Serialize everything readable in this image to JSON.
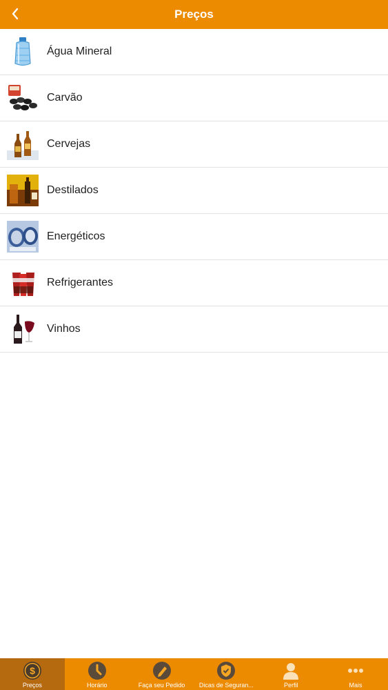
{
  "header": {
    "title": "Preços",
    "back_icon": "chevron-left-icon"
  },
  "colors": {
    "accent": "#ec8a00",
    "active_tab": "#b56a10"
  },
  "categories": [
    {
      "label": "Água Mineral",
      "icon": "water-bottle-icon"
    },
    {
      "label": "Carvão",
      "icon": "charcoal-icon"
    },
    {
      "label": "Cervejas",
      "icon": "beer-bottles-icon"
    },
    {
      "label": "Destilados",
      "icon": "spirits-icon"
    },
    {
      "label": "Energéticos",
      "icon": "energy-drink-icon"
    },
    {
      "label": "Refrigerantes",
      "icon": "soda-icon"
    },
    {
      "label": "Vinhos",
      "icon": "wine-icon"
    }
  ],
  "tabs": [
    {
      "label": "Preços",
      "icon": "dollar-icon",
      "active": true
    },
    {
      "label": "Horário",
      "icon": "clock-icon",
      "active": false
    },
    {
      "label": "Faça seu Pedido",
      "icon": "pencil-icon",
      "active": false
    },
    {
      "label": "Dicas de Seguran...",
      "icon": "shield-icon",
      "active": false
    },
    {
      "label": "Perfil",
      "icon": "person-icon",
      "active": false
    },
    {
      "label": "Mais",
      "icon": "more-icon",
      "active": false
    }
  ]
}
